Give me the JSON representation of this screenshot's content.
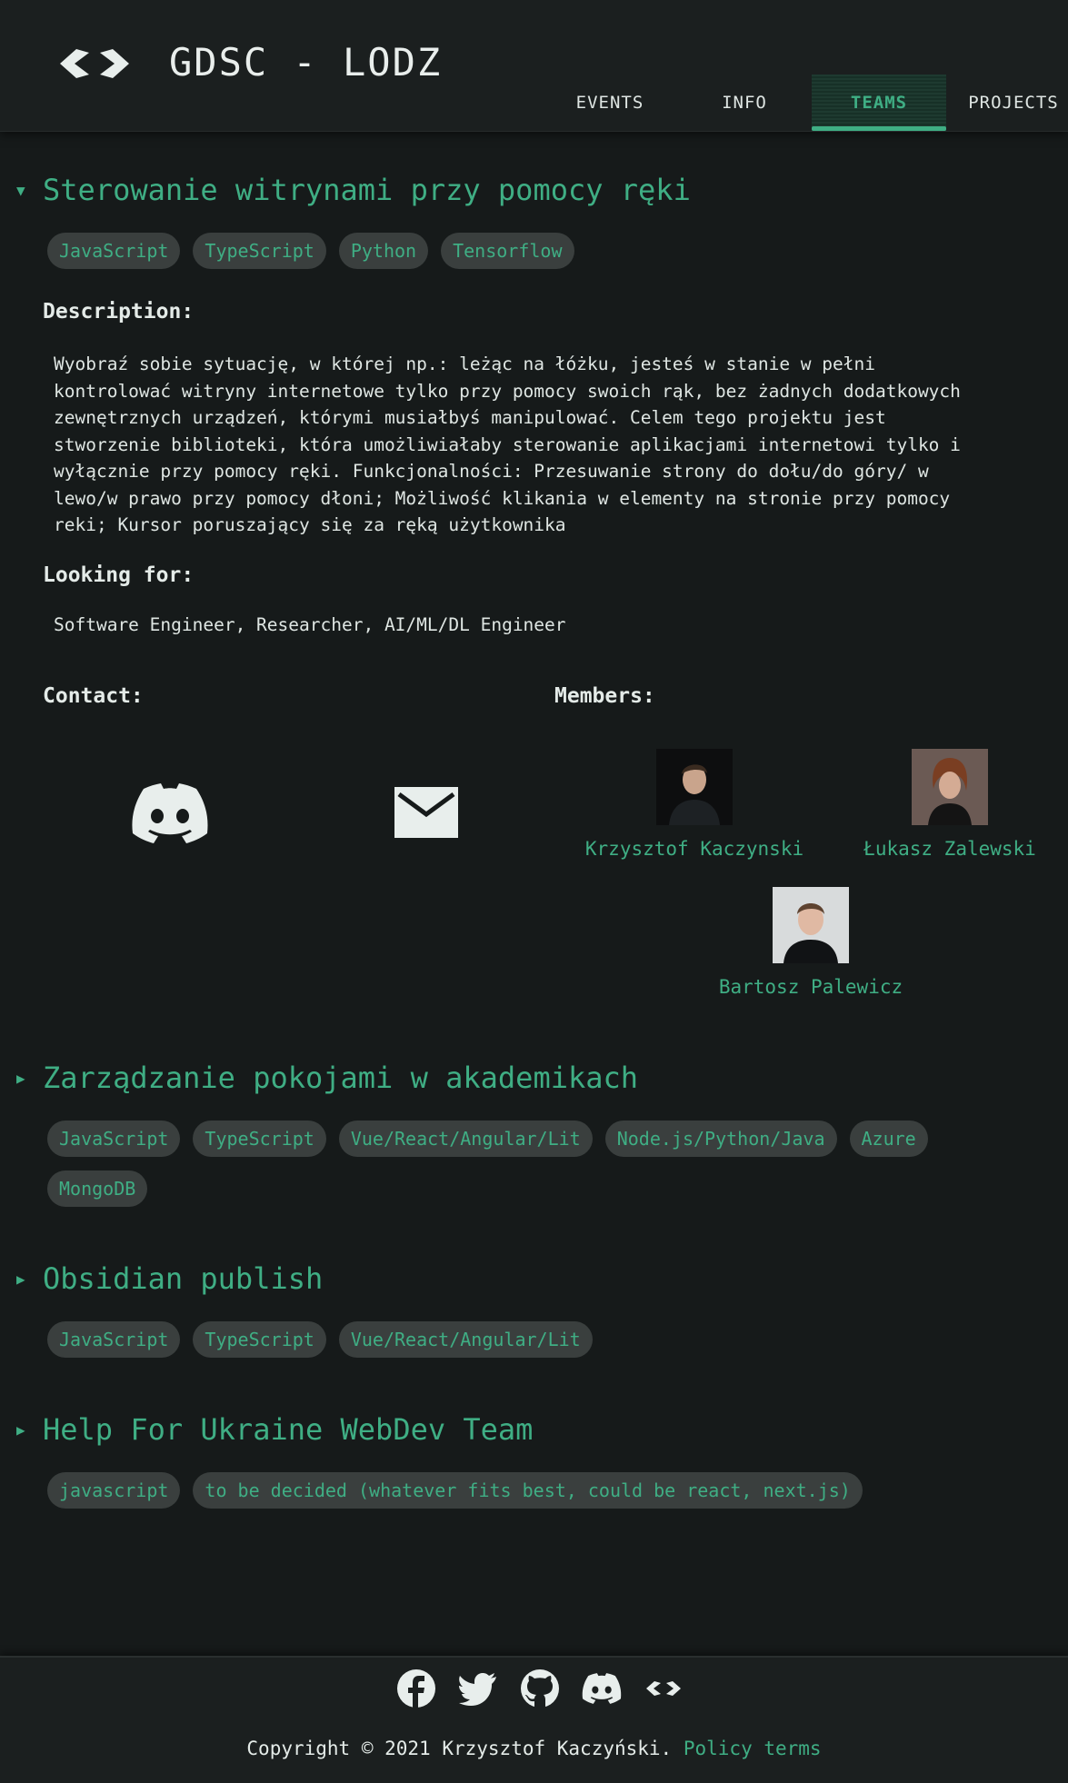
{
  "header": {
    "brand": "GDSC - LODZ",
    "logo_icon": "code-brackets-logo",
    "nav": [
      {
        "label": "EVENTS",
        "active": false
      },
      {
        "label": "INFO",
        "active": false
      },
      {
        "label": "TEAMS",
        "active": true
      },
      {
        "label": "PROJECTS",
        "active": false
      }
    ]
  },
  "projects": [
    {
      "title": "Sterowanie witrynami przy pomocy ręki",
      "expanded": true,
      "tags": [
        "JavaScript",
        "TypeScript",
        "Python",
        "Tensorflow"
      ],
      "description_label": "Description:",
      "description_lines": [
        "Wyobraź sobie sytuację, w której np.: leżąc na łóżku, jesteś w stanie w pełni",
        "kontrolować witryny internetowe tylko przy pomocy swoich rąk, bez żadnych dodatkowych",
        "zewnętrznych urządzeń, którymi musiałbyś manipulować. Celem tego projektu jest",
        "stworzenie biblioteki, która umożliwiałaby sterowanie aplikacjami internetowi tylko i",
        "wyłącznie przy pomocy ręki. Funkcjonalności: Przesuwanie strony do dołu/do góry/ w",
        "lewo/w prawo przy pomocy dłoni; Możliwość klikania w elementy na stronie przy pomocy",
        "reki; Kursor poruszający się za ręką użytkownika"
      ],
      "looking_label": "Looking for:",
      "looking_for": "Software Engineer, Researcher, AI/ML/DL Engineer",
      "contact_label": "Contact:",
      "contact_icons": [
        "discord-icon",
        "mail-icon"
      ],
      "members_label": "Members:",
      "members": [
        {
          "name": "Krzysztof Kaczynski",
          "avatar": "avatar-photo"
        },
        {
          "name": "Łukasz Zalewski",
          "avatar": "avatar-photo"
        },
        {
          "name": "Bartosz Palewicz",
          "avatar": "avatar-photo"
        }
      ]
    },
    {
      "title": "Zarządzanie pokojami w akademikach",
      "expanded": false,
      "tags": [
        "JavaScript",
        "TypeScript",
        "Vue/React/Angular/Lit",
        "Node.js/Python/Java",
        "Azure",
        "MongoDB"
      ]
    },
    {
      "title": "Obsidian publish",
      "expanded": false,
      "tags": [
        "JavaScript",
        "TypeScript",
        "Vue/React/Angular/Lit"
      ]
    },
    {
      "title": "Help For Ukraine WebDev Team",
      "expanded": false,
      "tags": [
        "javascript",
        "to be decided (whatever fits best, could be react, next.js)"
      ]
    }
  ],
  "footer": {
    "icons": [
      "facebook-icon",
      "twitter-icon",
      "github-icon",
      "discord-icon",
      "code-brackets-icon"
    ],
    "copyright": "Copyright © 2021 Krzysztof Kaczyński.",
    "policy": "Policy terms"
  },
  "colors": {
    "accent": "#3fae84",
    "background": "#161a1a",
    "tag_background": "#3a3f3e"
  }
}
